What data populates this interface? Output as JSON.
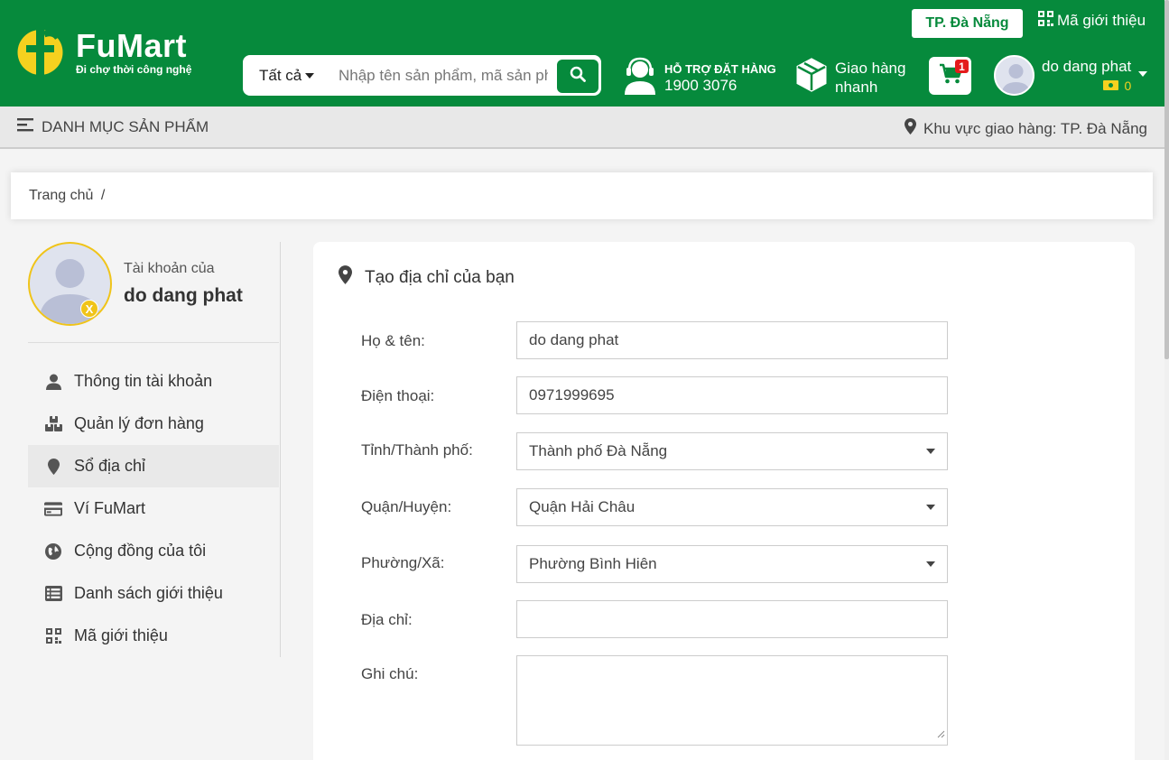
{
  "brand": {
    "name": "FuMart",
    "slogan": "Đi chợ thời công nghệ"
  },
  "header": {
    "city_button": "TP. Đà Nẵng",
    "referral_link": "Mã giới thiệu",
    "search": {
      "category": "Tất cả",
      "placeholder": "Nhập tên sản phẩm, mã sản phẩm"
    },
    "support": {
      "title": "HỖ TRỢ ĐẶT HÀNG",
      "phone": "1900 3076"
    },
    "delivery": {
      "line1": "Giao hàng",
      "line2": "nhanh"
    },
    "cart": {
      "count": "1"
    },
    "user": {
      "name": "do dang phat",
      "points": "0"
    }
  },
  "catbar": {
    "menu_label": "DANH MỤC SẢN PHẨM",
    "region_label": "Khu vực giao hàng: TP. Đà Nẵng"
  },
  "breadcrumb": {
    "home": "Trang chủ",
    "separator": "/"
  },
  "sidebar": {
    "account_of": "Tài khoản của",
    "username": "do dang phat",
    "badge": "X",
    "items": [
      {
        "label": "Thông tin tài khoản",
        "icon": "user-icon"
      },
      {
        "label": "Quản lý đơn hàng",
        "icon": "boxes-icon"
      },
      {
        "label": "Sổ địa chỉ",
        "icon": "map-marker-icon",
        "active": true
      },
      {
        "label": "Ví FuMart",
        "icon": "credit-card-icon"
      },
      {
        "label": "Cộng đồng của tôi",
        "icon": "globe-icon"
      },
      {
        "label": "Danh sách giới thiệu",
        "icon": "list-icon"
      },
      {
        "label": "Mã giới thiệu",
        "icon": "qrcode-icon"
      }
    ]
  },
  "form": {
    "title": "Tạo địa chỉ của bạn",
    "fullname": {
      "label": "Họ & tên:",
      "value": "do dang phat"
    },
    "phone": {
      "label": "Điện thoại:",
      "value": "0971999695"
    },
    "province": {
      "label": "Tỉnh/Thành phố:",
      "value": "Thành phố Đà Nẵng"
    },
    "district": {
      "label": "Quận/Huyện:",
      "value": "Quận Hải Châu"
    },
    "ward": {
      "label": "Phường/Xã:",
      "value": "Phường Bình Hiên"
    },
    "address": {
      "label": "Địa chỉ:",
      "value": ""
    },
    "note": {
      "label": "Ghi chú:",
      "value": ""
    }
  },
  "colors": {
    "brand_green": "#068a3c",
    "accent_yellow": "#f0c419",
    "badge_red": "#e41b1b"
  }
}
